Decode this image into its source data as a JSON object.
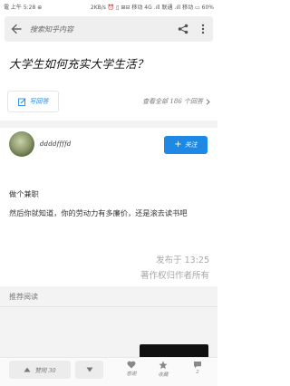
{
  "status_bar": {
    "left_text": "電 上午 5:28 ⊕",
    "right_text": "2KB/s ⏰ ▯ ⊞⊟ 移动 4G .ıll 联通 .ıll 移动 ▭ 60%"
  },
  "search": {
    "placeholder": "搜索知乎内容"
  },
  "question": {
    "title": "大学生如何充实大学生活？"
  },
  "actions": {
    "write_answer": "写回答",
    "view_all": "查看全部 186 个回答"
  },
  "author": {
    "name": "ddddffffd",
    "follow_label": "关注"
  },
  "answer": {
    "lines": [
      "做个兼职",
      "然后你就知道，你的劳动力有多廉价，还是滚去读书吧"
    ],
    "published": "发布于 13:25",
    "copyright": "著作权归作者所有"
  },
  "recommended": {
    "title": "推荐阅读"
  },
  "bottom_bar": {
    "upvote_label": "赞同 30",
    "thanks_label": "感谢",
    "collect_label": "收藏",
    "comment_label": "2"
  },
  "colors": {
    "accent": "#1e88e5",
    "meta_text": "#a7a7a7",
    "band": "#f3f3f3"
  }
}
